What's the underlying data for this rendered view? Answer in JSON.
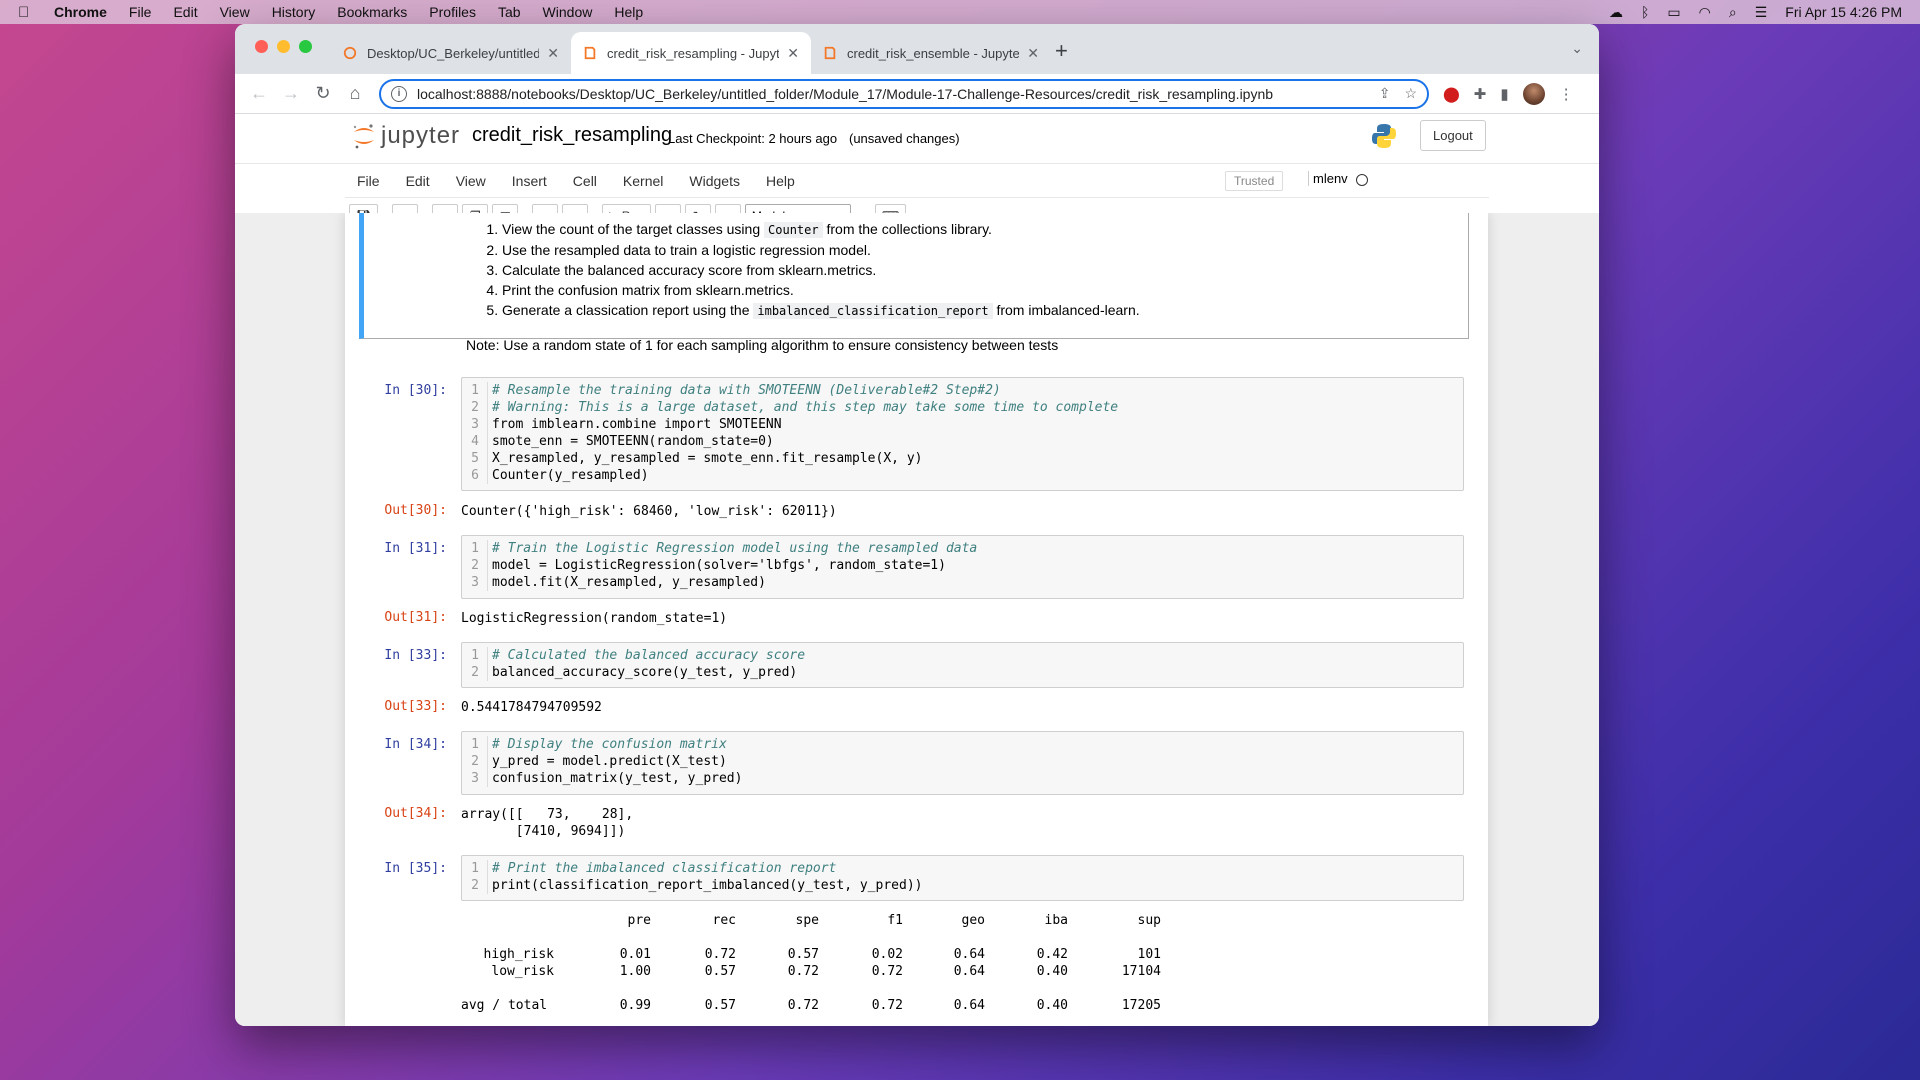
{
  "menubar": {
    "app": "Chrome",
    "items": [
      "File",
      "Edit",
      "View",
      "History",
      "Bookmarks",
      "Profiles",
      "Tab",
      "Window",
      "Help"
    ],
    "clock": "Fri Apr 15  4:26 PM"
  },
  "browser": {
    "tabs": [
      {
        "title": "Desktop/UC_Berkeley/untitled_",
        "active": false
      },
      {
        "title": "credit_risk_resampling - Jupyter",
        "active": true
      },
      {
        "title": "credit_risk_ensemble - Jupyter",
        "active": false
      }
    ],
    "url": "localhost:8888/notebooks/Desktop/UC_Berkeley/untitled_folder/Module_17/Module-17-Challenge-Resources/credit_risk_resampling.ipynb"
  },
  "jupyter": {
    "logo_text": "jupyter",
    "notebook_name": "credit_risk_resampling",
    "checkpoint": "Last Checkpoint: 2 hours ago",
    "unsaved": "(unsaved changes)",
    "logout": "Logout",
    "menus": [
      "File",
      "Edit",
      "View",
      "Insert",
      "Cell",
      "Kernel",
      "Widgets",
      "Help"
    ],
    "trusted": "Trusted",
    "kernel": "mlenv",
    "run_label": "Run",
    "cell_type": "Markdown"
  },
  "markdown": {
    "items": [
      [
        "View the count of the target classes using ",
        "Counter",
        " from the collections library."
      ],
      [
        "Use the resampled data to train a logistic regression model.",
        "",
        ""
      ],
      [
        "Calculate the balanced accuracy score from sklearn.metrics.",
        "",
        ""
      ],
      [
        "Print the confusion matrix from sklearn.metrics.",
        "",
        ""
      ],
      [
        "Generate a classication report using the ",
        "imbalanced_classification_report",
        " from imbalanced-learn."
      ]
    ],
    "note": "Note: Use a random state of 1 for each sampling algorithm to ensure consistency between tests"
  },
  "cells": [
    {
      "in": "In [30]:",
      "lines": [
        "# Resample the training data with SMOTEENN (Deliverable#2 Step#2)",
        "# Warning: This is a large dataset, and this step may take some time to complete",
        "from imblearn.combine import SMOTEENN",
        "smote_enn = SMOTEENN(random_state=0)",
        "X_resampled, y_resampled = smote_enn.fit_resample(X, y)",
        "Counter(y_resampled)"
      ],
      "out": "Out[30]:",
      "output": "Counter({'high_risk': 68460, 'low_risk': 62011})"
    },
    {
      "in": "In [31]:",
      "lines": [
        "# Train the Logistic Regression model using the resampled data",
        "model = LogisticRegression(solver='lbfgs', random_state=1)",
        "model.fit(X_resampled, y_resampled)"
      ],
      "out": "Out[31]:",
      "output": "LogisticRegression(random_state=1)"
    },
    {
      "in": "In [33]:",
      "lines": [
        "# Calculated the balanced accuracy score",
        "balanced_accuracy_score(y_test, y_pred)"
      ],
      "out": "Out[33]:",
      "output": "0.5441784794709592"
    },
    {
      "in": "In [34]:",
      "lines": [
        "# Display the confusion matrix",
        "y_pred = model.predict(X_test)",
        "confusion_matrix(y_test, y_pred)"
      ],
      "out": "Out[34]:",
      "output": "array([[   73,    28],\n       [7410, 9694]])"
    },
    {
      "in": "In [35]:",
      "lines": [
        "# Print the imbalanced classification report",
        "print(classification_report_imbalanced(y_test, y_pred))"
      ],
      "out": "",
      "output": ""
    }
  ],
  "report": {
    "headers": [
      "pre",
      "rec",
      "spe",
      "f1",
      "geo",
      "iba",
      "sup"
    ],
    "rows": [
      {
        "label": "high_risk",
        "values": [
          "0.01",
          "0.72",
          "0.57",
          "0.02",
          "0.64",
          "0.42",
          "101"
        ]
      },
      {
        "label": "low_risk",
        "values": [
          "1.00",
          "0.57",
          "0.72",
          "0.72",
          "0.64",
          "0.40",
          "17104"
        ]
      },
      {
        "label": "avg / total",
        "values": [
          "0.99",
          "0.57",
          "0.72",
          "0.72",
          "0.64",
          "0.40",
          "17205"
        ]
      }
    ]
  }
}
